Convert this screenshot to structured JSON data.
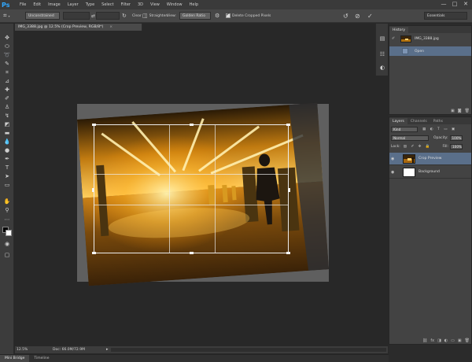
{
  "app": {
    "logo": "Ps"
  },
  "menu": [
    "File",
    "Edit",
    "Image",
    "Layer",
    "Type",
    "Select",
    "Filter",
    "3D",
    "View",
    "Window",
    "Help"
  ],
  "window_controls": [
    "—",
    "□",
    "✕"
  ],
  "options": {
    "ratio_value": "Unconstrained",
    "width_value": "",
    "height_value": "",
    "clear_label": "Clear",
    "straighten_label": "Straighten",
    "view_label": "View:",
    "view_value": "Golden Ratio",
    "delete_cropped_label": "Delete Cropped Pixels",
    "workspace_value": "Essentials"
  },
  "document": {
    "tab_title": "IMG_3388.jpg @ 12.5% (Crop Preview, RGB/8*)",
    "close_symbol": "×"
  },
  "status": {
    "zoom": "12.5%",
    "doc_info": "Doc: 66.0M/72.9M"
  },
  "bottom_tabs": [
    {
      "label": "Mini Bridge",
      "active": true
    },
    {
      "label": "Timeline",
      "active": false
    }
  ],
  "history": {
    "tabs": [
      "History"
    ],
    "items": [
      {
        "label": "IMG_3388.jpg"
      },
      {
        "label": "Open"
      }
    ]
  },
  "layers": {
    "tabs": [
      "Layers",
      "Channels",
      "Paths"
    ],
    "kind_label": "Kind",
    "blend_mode": "Normal",
    "opacity_label": "Opacity:",
    "opacity_value": "100%",
    "lock_label": "Lock:",
    "fill_label": "Fill:",
    "fill_value": "100%",
    "items": [
      {
        "name": "Crop Preview"
      },
      {
        "name": "Background"
      }
    ]
  },
  "colors": {
    "accent_selected": "#5a6f8a",
    "ps_blue": "#31a8ff"
  }
}
